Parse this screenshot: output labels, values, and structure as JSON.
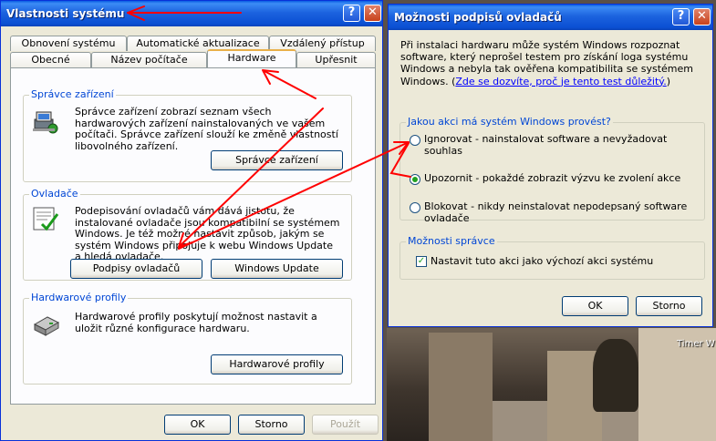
{
  "desktop": {
    "icon_label": "Timer W"
  },
  "sysprops": {
    "title": "Vlastnosti systému",
    "help_glyph": "?",
    "close_glyph": "✕",
    "tabs_row1": [
      "Obnovení systému",
      "Automatické aktualizace",
      "Vzdálený přístup"
    ],
    "tabs_row2": [
      "Obecné",
      "Název počítače",
      "Hardware",
      "Upřesnit"
    ],
    "active_tab": "Hardware",
    "groups": {
      "device_manager": {
        "label": "Správce zařízení",
        "text": "Správce zařízení zobrazí seznam všech hardwarových zařízení nainstalovaných ve vašem počítači. Správce zařízení slouží ke změně vlastností libovolného zařízení.",
        "button": "Správce zařízení",
        "icon": "device-manager-icon"
      },
      "drivers": {
        "label": "Ovladače",
        "text": "Podepisování ovladačů vám dává jistotu, že instalované ovladače jsou kompatibilní se systémem Windows. Je též možné nastavit způsob, jakým se systém Windows připojuje k webu Windows Update a hledá ovladače.",
        "button_sign": "Podpisy ovladačů",
        "button_update": "Windows Update",
        "icon": "driver-signing-icon"
      },
      "profiles": {
        "label": "Hardwarové profily",
        "text": "Hardwarové profily poskytují možnost nastavit a uložit různé konfigurace hardwaru.",
        "button": "Hardwarové profily",
        "icon": "hardware-profiles-icon"
      }
    },
    "buttons": {
      "ok": "OK",
      "cancel": "Storno",
      "apply": "Použít"
    }
  },
  "driversign": {
    "title": "Možnosti podpisů ovladačů",
    "help_glyph": "?",
    "close_glyph": "✕",
    "intro": "Při instalaci hardwaru může systém Windows rozpoznat software, který neprošel testem pro získání loga systému Windows a nebyla tak ověřena kompatibilita se systémem Windows. (",
    "intro_link": "Zde se dozvíte, proč je tento test důležitý.",
    "intro_end": ")",
    "action_group": "Jakou akci má systém Windows provést?",
    "options": [
      "Ignorovat - nainstalovat software a nevyžadovat souhlas",
      "Upozornit - pokaždé zobrazit výzvu ke zvolení akce",
      "Blokovat - nikdy neinstalovat nepodepsaný software ovladače"
    ],
    "selected_option": 1,
    "admin_group": "Možnosti správce",
    "admin_checkbox": "Nastavit tuto akci jako výchozí akci systému",
    "admin_checked": true,
    "buttons": {
      "ok": "OK",
      "cancel": "Storno"
    }
  },
  "annotation_color": "#ff0000"
}
